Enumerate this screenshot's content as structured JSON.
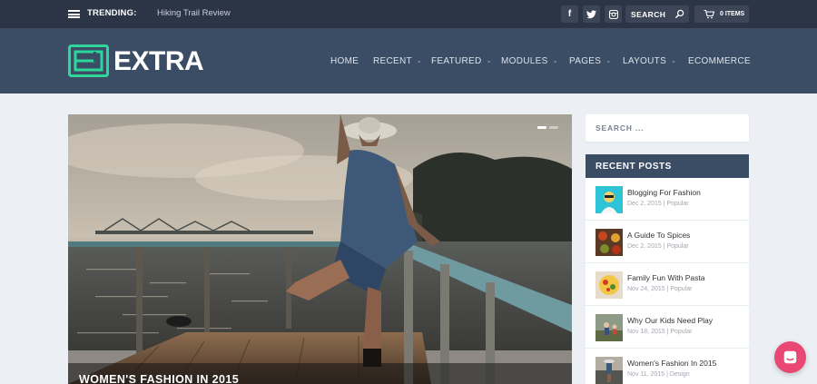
{
  "topbar": {
    "trending_label": "TRENDING:",
    "trending_link": "Hiking Trail Review",
    "social": [
      {
        "icon": "facebook-icon",
        "glyph": "f"
      },
      {
        "icon": "twitter-icon",
        "glyph": "t"
      },
      {
        "icon": "instagram-icon",
        "glyph": "◘"
      }
    ],
    "search_label": "SEARCH",
    "cart_label": "0 ITEMS"
  },
  "header": {
    "logo_text": "EXTRA",
    "logo_color": "#2ed69a",
    "nav": [
      {
        "label": "HOME",
        "dropdown": false
      },
      {
        "label": "RECENT",
        "dropdown": true
      },
      {
        "label": "FEATURED",
        "dropdown": true
      },
      {
        "label": "MODULES",
        "dropdown": true
      },
      {
        "label": "PAGES",
        "dropdown": true
      },
      {
        "label": "LAYOUTS",
        "dropdown": true
      },
      {
        "label": "ECOMMERCE",
        "dropdown": false
      }
    ]
  },
  "hero": {
    "title": "WOMEN'S FASHION IN 2015",
    "slides_count": 2,
    "active_slide": 1
  },
  "sidebar": {
    "search_placeholder": "SEARCH ...",
    "recent_heading": "RECENT POSTS",
    "posts": [
      {
        "title": "Blogging For Fashion",
        "meta": "Dec 2, 2015 | Popular"
      },
      {
        "title": "A Guide To Spices",
        "meta": "Dec 2, 2015 | Popular"
      },
      {
        "title": "Family Fun With Pasta",
        "meta": "Nov 24, 2015 | Popular"
      },
      {
        "title": "Why Our Kids Need Play",
        "meta": "Nov 18, 2015 | Popular"
      },
      {
        "title": "Women's Fashion In 2015",
        "meta": "Nov 11, 2015 | Design"
      }
    ]
  },
  "colors": {
    "topbar_bg": "#2b3545",
    "header_bg": "#3b4d65",
    "page_bg": "#ecf0f5",
    "chat_bg": "#e84873"
  }
}
